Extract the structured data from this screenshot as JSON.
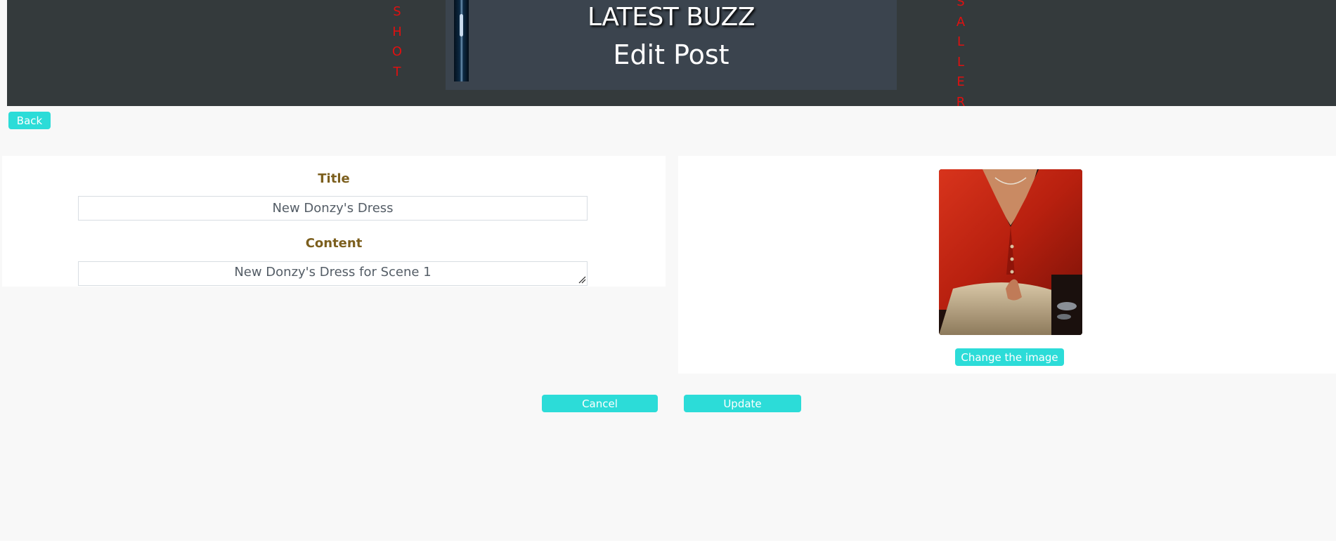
{
  "header": {
    "side_word_left": [
      "S",
      "H",
      "O",
      "T"
    ],
    "side_word_right": [
      "S",
      "A",
      "L",
      "L",
      "E",
      "R"
    ],
    "title": "LATEST BUZZ",
    "subtitle": "Edit Post"
  },
  "nav": {
    "back_label": "Back"
  },
  "form": {
    "title_label": "Title",
    "title_value": "New Donzy's Dress",
    "content_label": "Content",
    "content_value": "New Donzy's Dress for Scene 1"
  },
  "image_panel": {
    "change_label": "Change the image"
  },
  "actions": {
    "cancel_label": "Cancel",
    "update_label": "Update"
  },
  "colors": {
    "accent": "#2cdcd8",
    "header_bg": "#343a3c",
    "side_word": "#e01010",
    "label": "#7c5f1e"
  }
}
